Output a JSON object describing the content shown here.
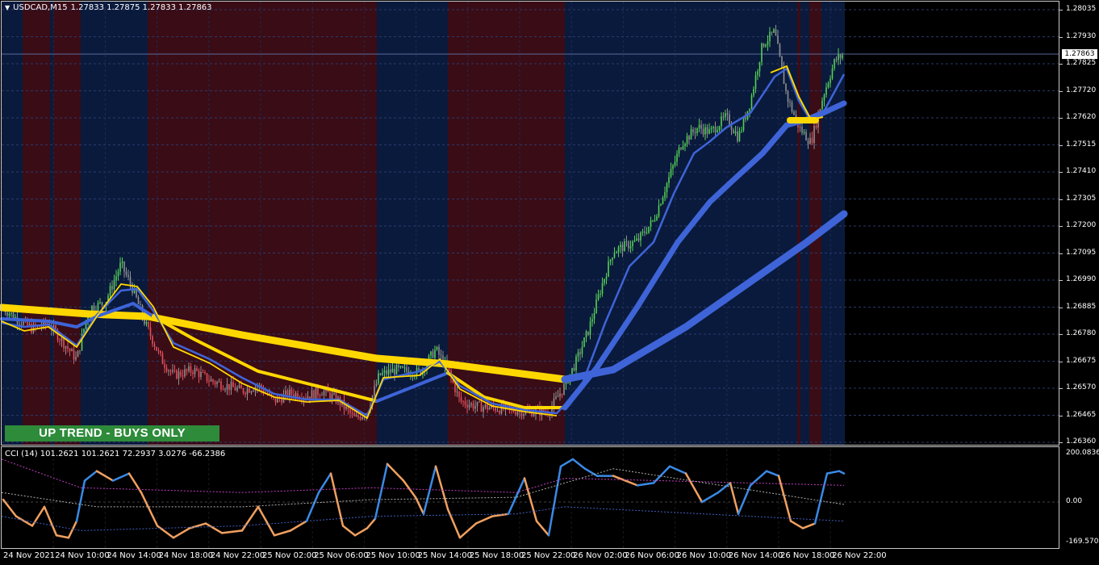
{
  "header": {
    "symbol": "USDCAD,M15",
    "ohlc": "1.27833 1.27875 1.27833 1.27863"
  },
  "indicator": {
    "title": "CCI (14) 101.2621 101.2621 72.2937 3.0276 -66.2386"
  },
  "banner": {
    "text": "UP TREND - BUYS ONLY",
    "color": "#2e8b3a"
  },
  "current_price": "1.27863",
  "price_axis": [
    "1.28035",
    "1.27930",
    "1.27825",
    "1.27720",
    "1.27620",
    "1.27515",
    "1.27410",
    "1.27305",
    "1.27200",
    "1.27095",
    "1.26990",
    "1.26885",
    "1.26780",
    "1.26675",
    "1.26570",
    "1.26465",
    "1.26360"
  ],
  "cci_axis": [
    "200.0836",
    "0.00",
    "-169.5707"
  ],
  "time_axis": [
    "24 Nov 2021",
    "24 Nov 10:00",
    "24 Nov 14:00",
    "24 Nov 18:00",
    "24 Nov 22:00",
    "25 Nov 02:00",
    "25 Nov 06:00",
    "25 Nov 10:00",
    "25 Nov 14:00",
    "25 Nov 18:00",
    "25 Nov 22:00",
    "26 Nov 02:00",
    "26 Nov 06:00",
    "26 Nov 10:00",
    "26 Nov 14:00",
    "26 Nov 18:00",
    "26 Nov 22:00"
  ],
  "colors": {
    "bull": "#55d155",
    "bear": "#e0505a",
    "neutral": "#909090",
    "blue_bg": "#0a1a3c",
    "red_bg": "#3a0c16",
    "ma_yellow": "#ffd700",
    "ma_blue": "#3e64d8",
    "cci_blue": "#3a8ae6",
    "cci_orange": "#f0a060"
  },
  "chart_data": {
    "type": "candlestick",
    "symbol": "USDCAD",
    "timeframe": "M15",
    "ylim": [
      1.2636,
      1.28035
    ],
    "approx_close_path": [
      {
        "t": "24 Nov 2021",
        "price": 1.2688
      },
      {
        "t": "24 Nov 10:00",
        "price": 1.2675
      },
      {
        "t": "24 Nov 14:00",
        "price": 1.2703
      },
      {
        "t": "24 Nov 18:00",
        "price": 1.2664
      },
      {
        "t": "24 Nov 22:00",
        "price": 1.2662
      },
      {
        "t": "25 Nov 02:00",
        "price": 1.2655
      },
      {
        "t": "25 Nov 06:00",
        "price": 1.2648
      },
      {
        "t": "25 Nov 10:00",
        "price": 1.2667
      },
      {
        "t": "25 Nov 14:00",
        "price": 1.2672
      },
      {
        "t": "25 Nov 18:00",
        "price": 1.265
      },
      {
        "t": "25 Nov 22:00",
        "price": 1.2649
      },
      {
        "t": "26 Nov 02:00",
        "price": 1.27
      },
      {
        "t": "26 Nov 06:00",
        "price": 1.2724
      },
      {
        "t": "26 Nov 10:00",
        "price": 1.2758
      },
      {
        "t": "26 Nov 14:00",
        "price": 1.279
      },
      {
        "t": "26 Nov 18:00",
        "price": 1.2752
      },
      {
        "t": "26 Nov 22:00",
        "price": 1.27863
      }
    ],
    "cci_range": [
      -169.5707,
      200.0836
    ]
  }
}
